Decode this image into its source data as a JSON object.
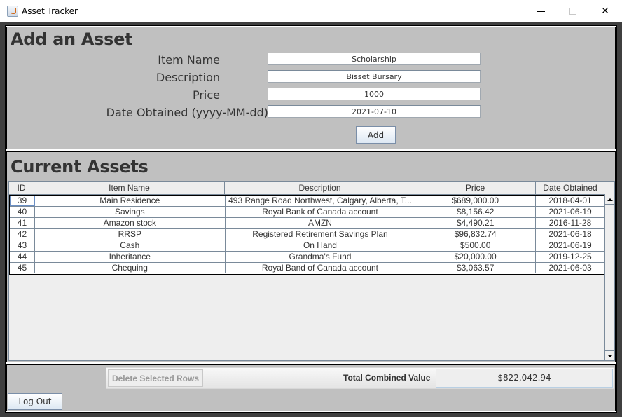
{
  "window": {
    "title": "Asset Tracker",
    "controls": {
      "minimize": "minimize",
      "maximize": "maximize",
      "close": "close"
    }
  },
  "add_asset": {
    "heading": "Add an Asset",
    "fields": [
      {
        "label": "Item Name",
        "value": "Scholarship"
      },
      {
        "label": "Description",
        "value": "Bisset Bursary"
      },
      {
        "label": "Price",
        "value": "1000"
      },
      {
        "label": "Date Obtained (yyyy-MM-dd)",
        "value": "2021-07-10"
      }
    ],
    "add_button": "Add"
  },
  "current_assets": {
    "heading": "Current Assets",
    "columns": [
      "ID",
      "Item Name",
      "Description",
      "Price",
      "Date Obtained"
    ],
    "rows": [
      {
        "id": "39",
        "name": "Main Residence",
        "description": "493 Range Road Northwest, Calgary, Alberta, T...",
        "price": "$689,000.00",
        "date": "2018-04-01"
      },
      {
        "id": "40",
        "name": "Savings",
        "description": "Royal Bank of Canada account",
        "price": "$8,156.42",
        "date": "2021-06-19"
      },
      {
        "id": "41",
        "name": "Amazon stock",
        "description": "AMZN",
        "price": "$4,490.21",
        "date": "2016-11-28"
      },
      {
        "id": "42",
        "name": "RRSP",
        "description": "Registered Retirement Savings Plan",
        "price": "$96,832.74",
        "date": "2021-06-18"
      },
      {
        "id": "43",
        "name": "Cash",
        "description": "On Hand",
        "price": "$500.00",
        "date": "2021-06-19"
      },
      {
        "id": "44",
        "name": "Inheritance",
        "description": "Grandma's Fund",
        "price": "$20,000.00",
        "date": "2019-12-25"
      },
      {
        "id": "45",
        "name": "Chequing",
        "description": "Royal Band of Canada account",
        "price": "$3,063.57",
        "date": "2021-06-03"
      }
    ]
  },
  "footer": {
    "delete_button": "Delete Selected Rows",
    "total_label": "Total Combined Value",
    "total_value": "$822,042.94",
    "logout_button": "Log Out"
  }
}
